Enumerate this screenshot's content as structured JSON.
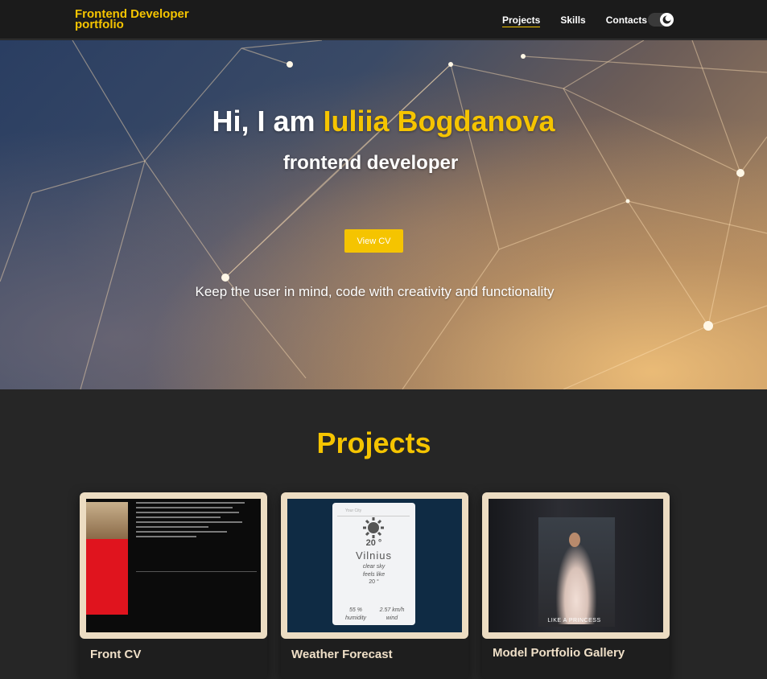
{
  "nav": {
    "brand": "Frontend Developer portfolio",
    "items": [
      "Projects",
      "Skills",
      "Contacts"
    ],
    "active": "Projects",
    "theme_toggle_icon": "moon-icon"
  },
  "hero": {
    "greeting": "Hi, I am ",
    "name": "Iuliia Bogdanova",
    "role": "frontend developer",
    "cv_button": "View CV",
    "tagline": "Keep the user in mind, code with creativity and functionality"
  },
  "projects": {
    "title": "Projects",
    "cards": [
      {
        "title": "Front CV"
      },
      {
        "title": "Weather Forecast",
        "preview": {
          "search_placeholder": "Your City",
          "temp": "20 °",
          "city": "Vilnius",
          "desc": "clear sky",
          "feels_label": "feels like",
          "feels": "20 °",
          "humidity": "55 %",
          "humidity_label": "humidity",
          "wind": "2.57 km/h",
          "wind_label": "wind"
        }
      },
      {
        "title": "Model Portfolio Gallery",
        "preview": {
          "caption": "LIKE A PRINCESS"
        }
      }
    ]
  },
  "colors": {
    "accent": "#f5c400",
    "background": "#262626",
    "nav": "#1b1b1b"
  }
}
